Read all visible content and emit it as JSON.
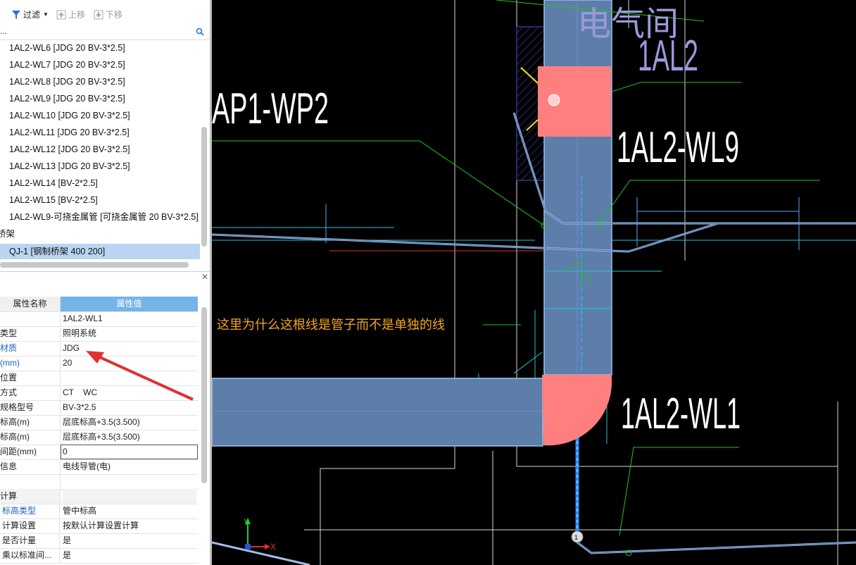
{
  "toolbar": {
    "filter_label": "过滤",
    "move_up_label": "上移",
    "move_down_label": "下移"
  },
  "search": {
    "placeholder": "..."
  },
  "tree": {
    "items": [
      "1AL2-WL6 [JDG 20 BV-3*2.5]",
      "1AL2-WL7 [JDG 20 BV-3*2.5]",
      "1AL2-WL8 [JDG 20 BV-3*2.5]",
      "1AL2-WL9 [JDG 20 BV-3*2.5]",
      "1AL2-WL10 [JDG 20 BV-3*2.5]",
      "1AL2-WL11 [JDG 20 BV-3*2.5]",
      "1AL2-WL12 [JDG 20 BV-3*2.5]",
      "1AL2-WL13 [JDG 20 BV-3*2.5]",
      "1AL2-WL14 [BV-2*2.5]",
      "1AL2-WL15 [BV-2*2.5]",
      "1AL2-WL9-可挠金属管 [可挠金属管 20 BV-3*2.5]"
    ],
    "group_label": "桥架",
    "selected_item": "QJ-1 [钢制桥架 400 200]"
  },
  "properties": {
    "header_name": "属性名称",
    "header_value": "属性值",
    "rows": [
      {
        "name": "",
        "value": "1AL2-WL1"
      },
      {
        "name": "类型",
        "value": "照明系统"
      },
      {
        "name": "材质",
        "value": "JDG"
      },
      {
        "name": "(mm)",
        "value": "20"
      },
      {
        "name": "位置",
        "value": ""
      },
      {
        "name": "方式",
        "value": "CT    WC"
      },
      {
        "name": "规格型号",
        "value": "BV-3*2.5"
      },
      {
        "name": "标高(m)",
        "value": "层底标高+3.5(3.500)"
      },
      {
        "name": "标高(m)",
        "value": "层底标高+3.5(3.500)"
      },
      {
        "name": "间距(mm)",
        "value": "0"
      },
      {
        "name": "信息",
        "value": "电线导管(电)"
      },
      {
        "name": "",
        "value": ""
      },
      {
        "name": "计算",
        "value": ""
      },
      {
        "name": "标高类型",
        "value": "管中标高"
      },
      {
        "name": "计算设置",
        "value": "按默认计算设置计算"
      },
      {
        "name": "是否计量",
        "value": "是"
      },
      {
        "name": "乘以标准间...",
        "value": "是"
      }
    ]
  },
  "cad": {
    "labels": {
      "top_partial": "电气间",
      "al2": "1AL2",
      "ap1": "AP1-WP2",
      "wl9": "1AL2-WL9",
      "wl1": "1AL2-WL1",
      "axis_x": "X",
      "axis_y": "Y"
    },
    "annotation": "这里为什么这根线是管子而不是单独的线",
    "colors": {
      "pipe": "#5d7ea9",
      "pipe_edge": "#9ec0f0",
      "box": "#ff7f7f",
      "green": "#22c422",
      "annotation": "#f3a61c",
      "arrow": "#e03030"
    }
  }
}
